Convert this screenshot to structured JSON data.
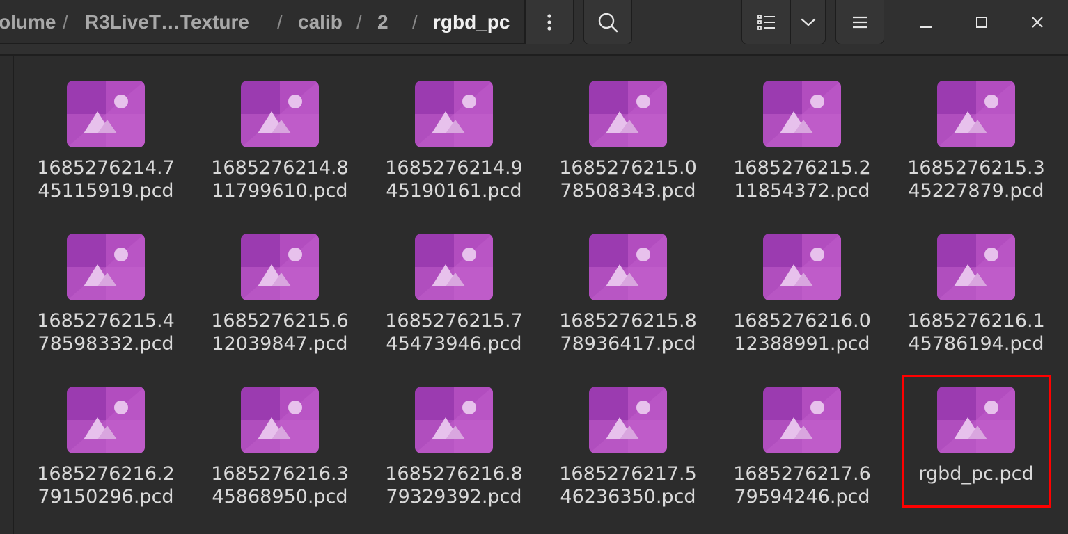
{
  "header": {
    "breadcrumb": [
      {
        "label": "olume"
      },
      {
        "label": "R3LiveT…Texture"
      },
      {
        "label": "calib"
      },
      {
        "label": "2"
      },
      {
        "label": "rgbd_pc"
      }
    ],
    "separator": "/",
    "buttons": {
      "menu_icon": "vertical-dots-icon",
      "search_icon": "search-icon",
      "list_view_icon": "list-view-icon",
      "view_options_icon": "chevron-down-icon",
      "main_menu_icon": "hamburger-icon"
    },
    "window_controls": [
      "minimize-icon",
      "maximize-icon",
      "close-icon"
    ]
  },
  "files": [
    {
      "line1": "1685276214.7",
      "line2": "45115919.pcd"
    },
    {
      "line1": "1685276214.8",
      "line2": "11799610.pcd"
    },
    {
      "line1": "1685276214.9",
      "line2": "45190161.pcd"
    },
    {
      "line1": "1685276215.0",
      "line2": "78508343.pcd"
    },
    {
      "line1": "1685276215.2",
      "line2": "11854372.pcd"
    },
    {
      "line1": "1685276215.3",
      "line2": "45227879.pcd"
    },
    {
      "line1": "1685276215.4",
      "line2": "78598332.pcd"
    },
    {
      "line1": "1685276215.6",
      "line2": "12039847.pcd"
    },
    {
      "line1": "1685276215.7",
      "line2": "45473946.pcd"
    },
    {
      "line1": "1685276215.8",
      "line2": "78936417.pcd"
    },
    {
      "line1": "1685276216.0",
      "line2": "12388991.pcd"
    },
    {
      "line1": "1685276216.1",
      "line2": "45786194.pcd"
    },
    {
      "line1": "1685276216.2",
      "line2": "79150296.pcd"
    },
    {
      "line1": "1685276216.3",
      "line2": "45868950.pcd"
    },
    {
      "line1": "1685276216.8",
      "line2": "79329392.pcd"
    },
    {
      "line1": "1685276217.5",
      "line2": "46236350.pcd"
    },
    {
      "line1": "1685276217.6",
      "line2": "79594246.pcd"
    },
    {
      "line1": "rgbd_pc.pcd",
      "line2": ""
    }
  ],
  "colors": {
    "icon_dark": "#9b3bb0",
    "icon_light": "#c15fcb",
    "highlight": "#ff0000"
  },
  "file_icon": "image-file-icon"
}
